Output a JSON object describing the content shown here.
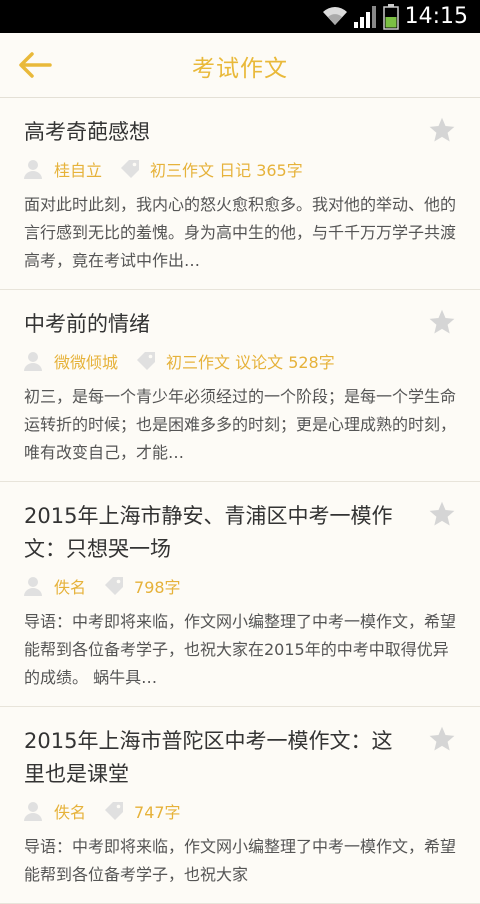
{
  "status_bar": {
    "time": "14:15"
  },
  "header": {
    "title": "考试作文"
  },
  "articles": [
    {
      "title": "高考奇葩感想",
      "author": "桂自立",
      "tags": "初三作文 日记 365字",
      "excerpt": "面对此时此刻，我内心的怒火愈积愈多。我对他的举动、他的言行感到无比的羞愧。身为高中生的他，与千千万万学子共渡高考，竟在考试中作出…"
    },
    {
      "title": "中考前的情绪",
      "author": "微微倾城",
      "tags": "初三作文 议论文 528字",
      "excerpt": "初三，是每一个青少年必须经过的一个阶段；是每一个学生命运转折的时候；也是困难多多的时刻；更是心理成熟的时刻，唯有改变自己，才能…"
    },
    {
      "title": "2015年上海市静安、青浦区中考一模作文：只想哭一场",
      "author": "佚名",
      "tags": "798字",
      "excerpt": "导语：中考即将来临，作文网小编整理了中考一模作文，希望能帮到各位备考学子，也祝大家在2015年的中考中取得优异的成绩。 蜗牛具…"
    },
    {
      "title": "2015年上海市普陀区中考一模作文：这里也是课堂",
      "author": "佚名",
      "tags": "747字",
      "excerpt": "导语：中考即将来临，作文网小编整理了中考一模作文，希望能帮到各位备考学子，也祝大家"
    }
  ],
  "colors": {
    "accent": "#e9b93a",
    "star": "#d5d5d5",
    "background": "#fdfbf6"
  }
}
